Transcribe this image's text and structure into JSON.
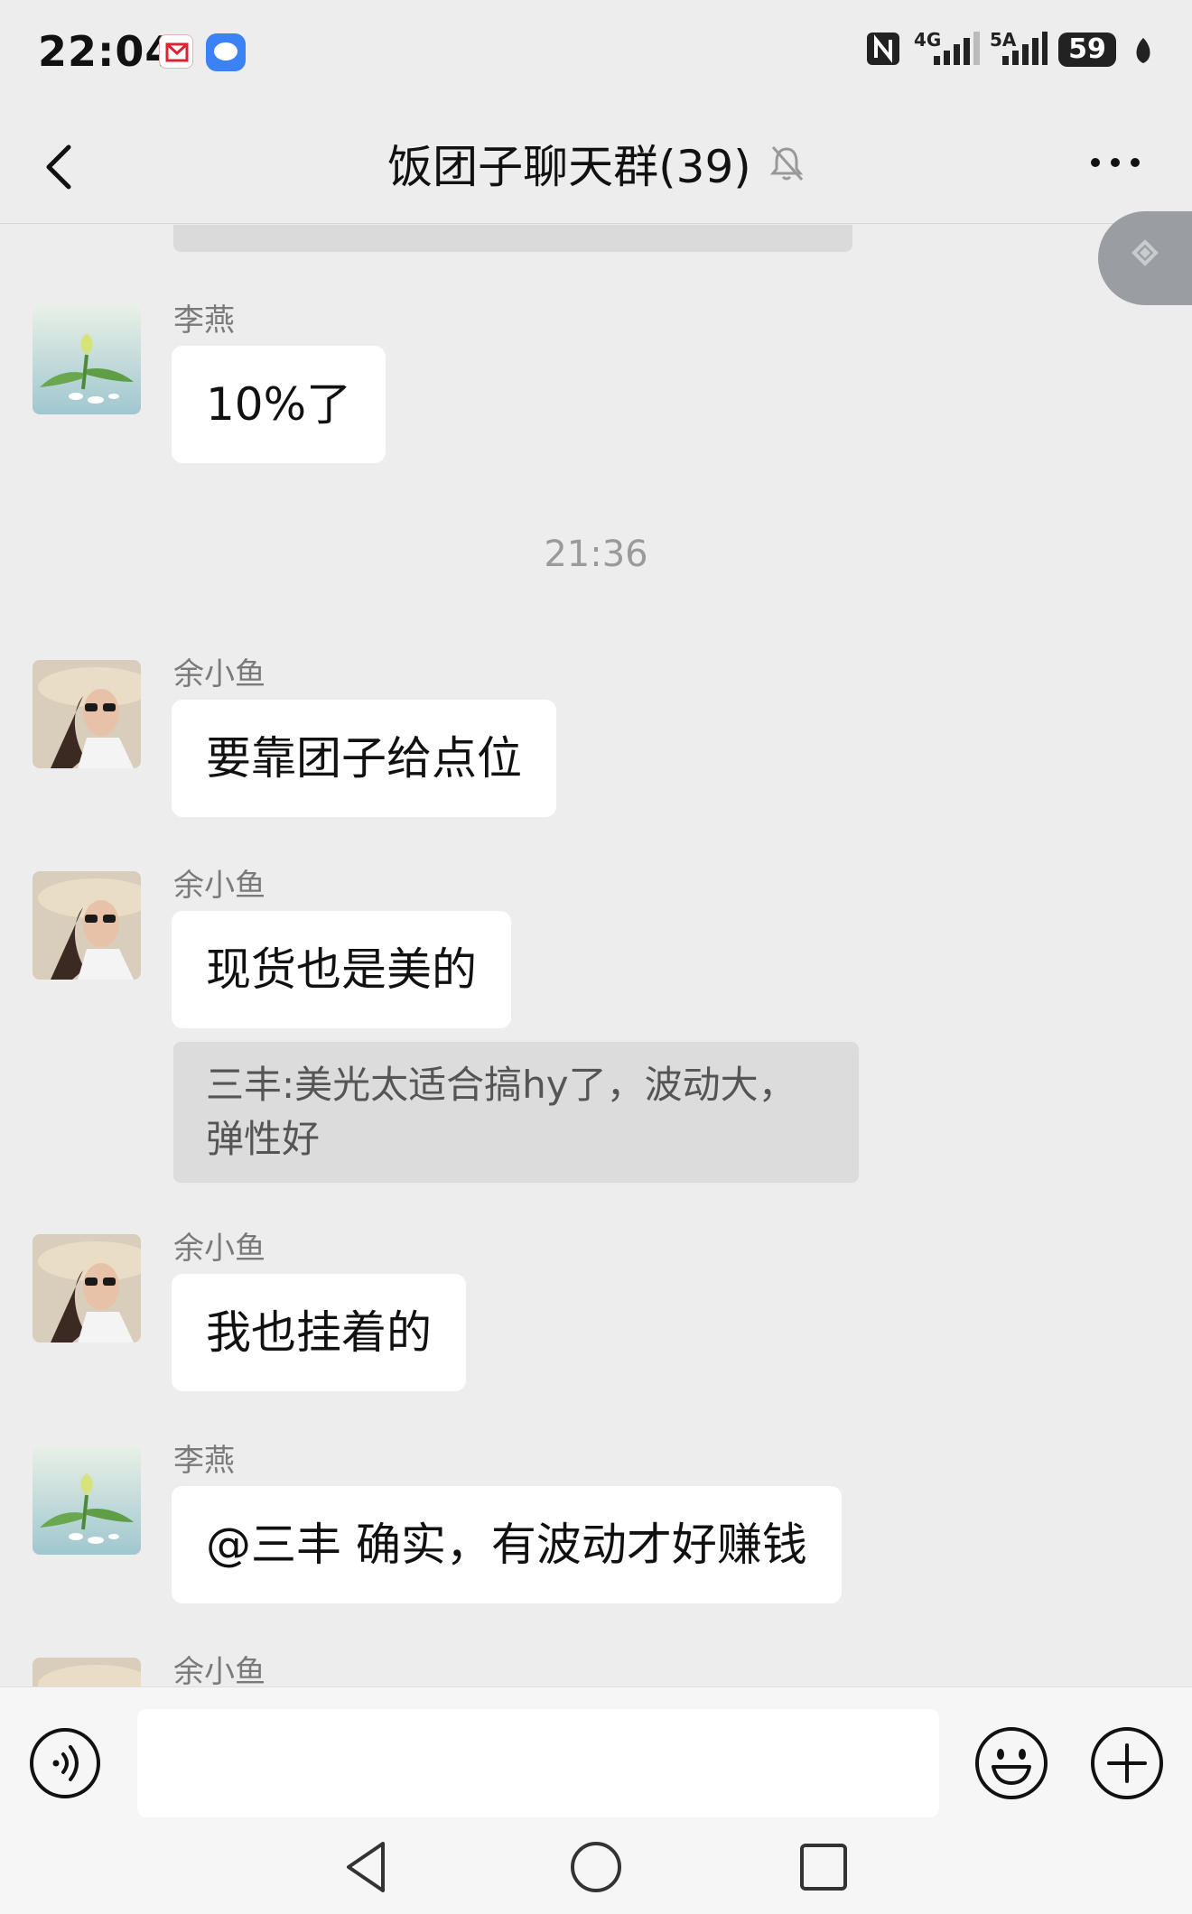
{
  "status_bar": {
    "time": "22:04",
    "network_1": "4G",
    "network_2": "5A",
    "battery": "59"
  },
  "header": {
    "title": "饭团子聊天群(39)"
  },
  "messages": [
    {
      "sender": "李燕",
      "text": "10%了",
      "avatar": "lotus-avatar"
    },
    {
      "sender": "余小鱼",
      "text": "要靠团子给点位",
      "avatar": "woman-hat-avatar"
    },
    {
      "sender": "余小鱼",
      "text": "现货也是美的",
      "avatar": "woman-hat-avatar"
    },
    {
      "sender": "余小鱼",
      "text": "我也挂着的",
      "avatar": "woman-hat-avatar"
    },
    {
      "sender": "李燕",
      "text": "@三丰 确实，有波动才好赚钱",
      "avatar": "lotus-avatar"
    },
    {
      "sender": "余小鱼",
      "text": "",
      "avatar": "woman-hat-avatar"
    }
  ],
  "time_separator": "21:36",
  "quote": {
    "text": "三丰:美光太适合搞hy了，波动大，弹性好"
  },
  "input": {
    "value": "",
    "placeholder": ""
  },
  "icons": {
    "back": "chevron-left-icon",
    "mute": "bell-off-icon",
    "more": "more-dots-icon",
    "voice": "voice-icon",
    "emoji": "emoji-icon",
    "plus": "plus-icon"
  }
}
